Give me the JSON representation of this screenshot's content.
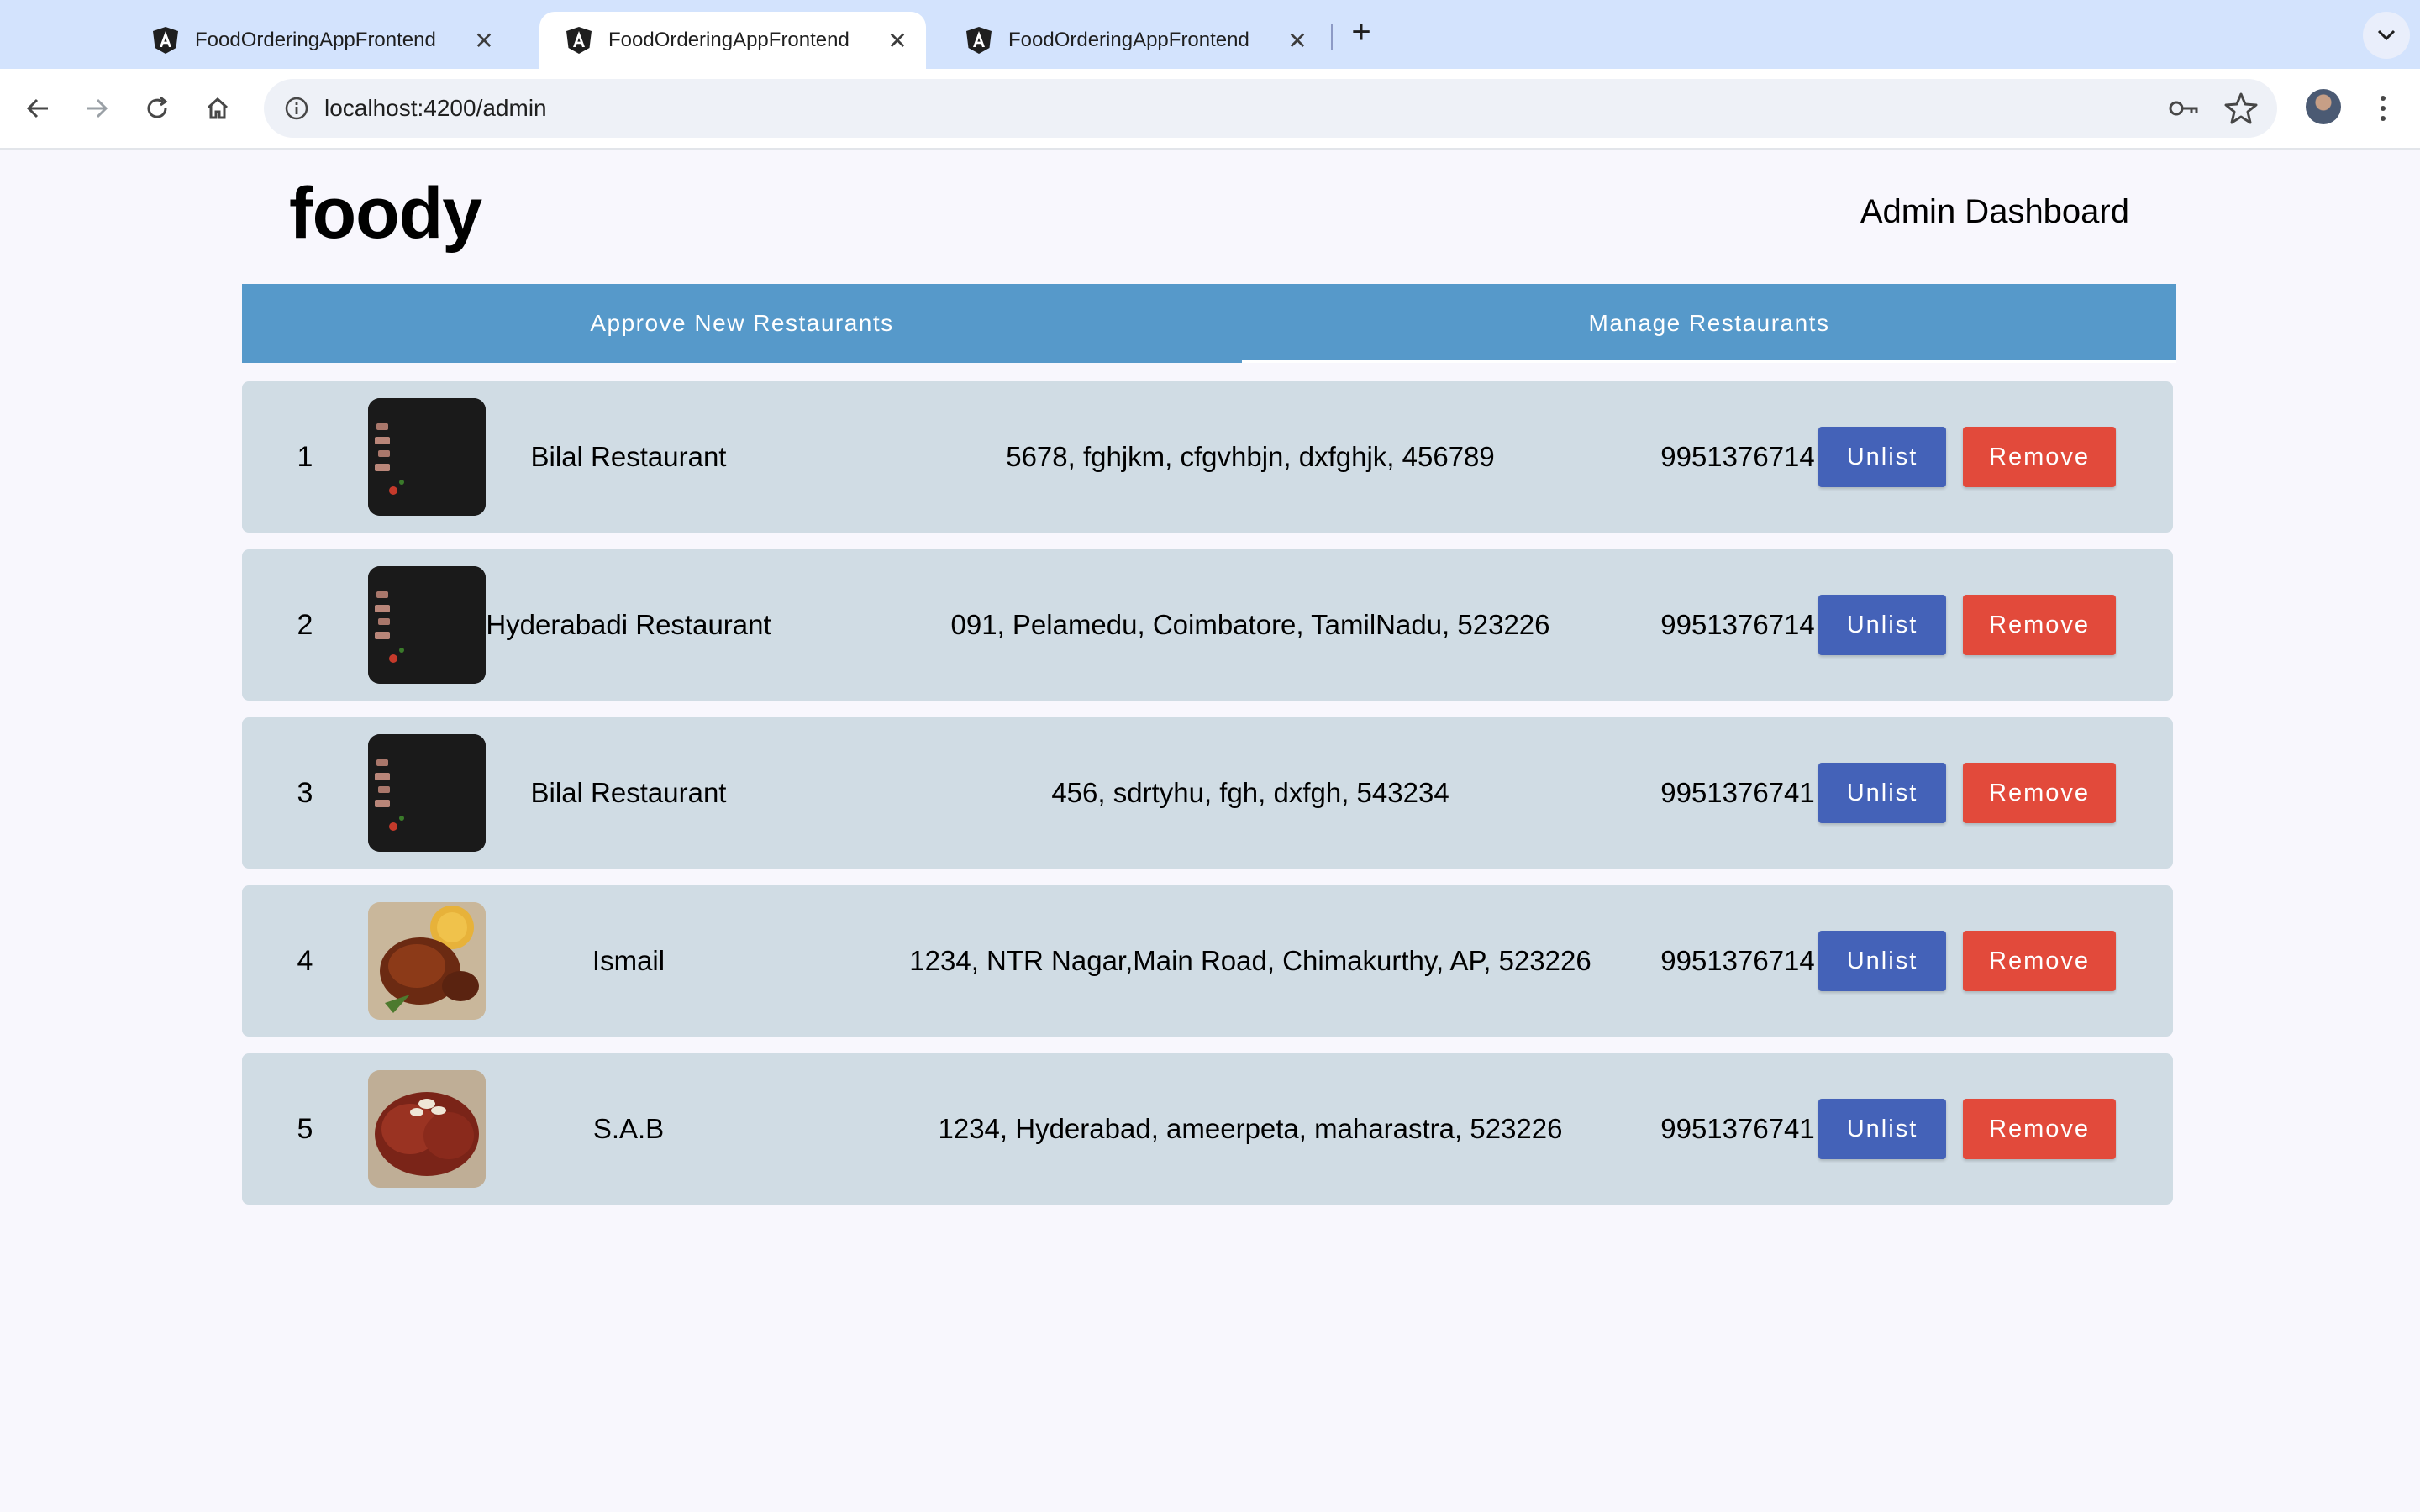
{
  "browser": {
    "tabs": [
      {
        "title": "FoodOrderingAppFrontend",
        "active": false
      },
      {
        "title": "FoodOrderingAppFrontend",
        "active": true
      },
      {
        "title": "FoodOrderingAppFrontend",
        "active": false
      }
    ],
    "url": "localhost:4200/admin"
  },
  "header": {
    "brand": "foody",
    "title": "Admin Dashboard"
  },
  "page_tabs": [
    {
      "label": "Approve New Restaurants",
      "selected": false
    },
    {
      "label": "Manage Restaurants",
      "selected": true
    }
  ],
  "colors": {
    "tab_bar": "#5699ca",
    "row_bg": "#d0dce4",
    "unlist_button": "#4462b8",
    "remove_button": "#e24a3b"
  },
  "restaurants": [
    {
      "index": "1",
      "name": "Bilal Restaurant",
      "address": "5678, fghjkm, cfgvhbjn, dxfghjk, 456789",
      "phone": "9951376714",
      "image": "grilled-meat"
    },
    {
      "index": "2",
      "name": "Hyderabadi Restaurant",
      "address": "091, Pelamedu, Coimbatore, TamilNadu, 523226",
      "phone": "9951376714",
      "image": "grilled-meat"
    },
    {
      "index": "3",
      "name": "Bilal Restaurant",
      "address": "456, sdrtyhu, fgh, dxfgh, 543234",
      "phone": "9951376741",
      "image": "grilled-meat"
    },
    {
      "index": "4",
      "name": "Ismail",
      "address": "1234, NTR Nagar,Main Road, Chimakurthy, AP, 523226",
      "phone": "9951376714",
      "image": "roast-chicken"
    },
    {
      "index": "5",
      "name": "S.A.B",
      "address": "1234, Hyderabad, ameerpeta, maharastra, 523226",
      "phone": "9951376741",
      "image": "gulab-jamun"
    }
  ],
  "actions": {
    "unlist_label": "Unlist",
    "remove_label": "Remove"
  }
}
